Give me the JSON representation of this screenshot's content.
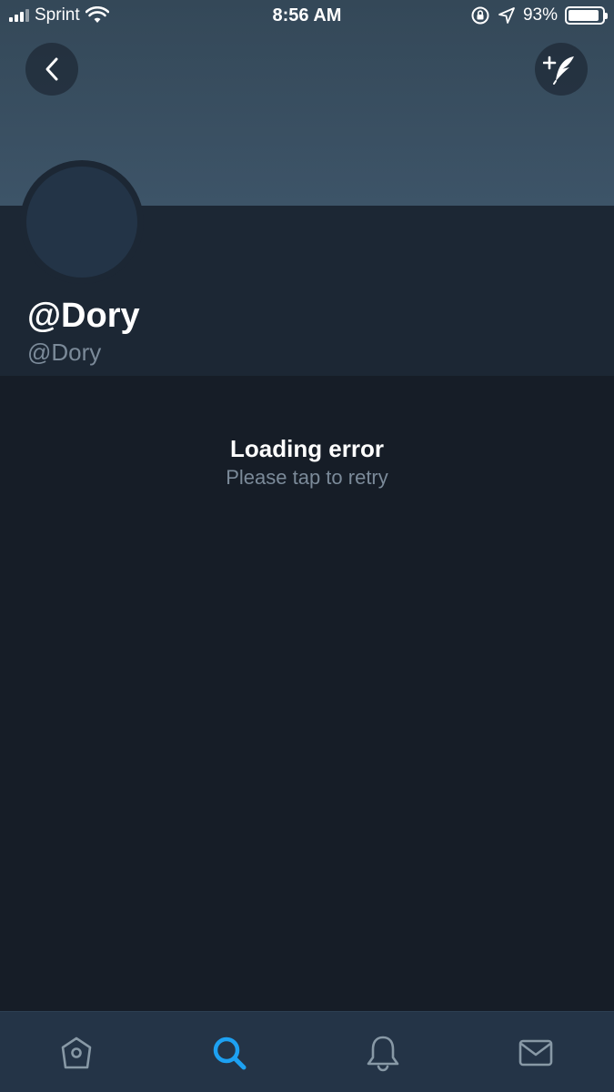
{
  "status_bar": {
    "carrier": "Sprint",
    "time": "8:56 AM",
    "battery_percent": "93%",
    "battery_level": 0.93
  },
  "header": {
    "back_icon": "chevron-left-icon",
    "compose_icon": "compose-tweet-icon"
  },
  "profile": {
    "display_name": "@Dory",
    "handle": "@Dory"
  },
  "error": {
    "title": "Loading error",
    "subtitle": "Please tap to retry"
  },
  "tab_bar": {
    "items": [
      {
        "icon": "home-icon",
        "active": false
      },
      {
        "icon": "search-icon",
        "active": true
      },
      {
        "icon": "notifications-icon",
        "active": false
      },
      {
        "icon": "messages-icon",
        "active": false
      }
    ]
  },
  "colors": {
    "accent": "#1da1f2",
    "background": "#161d27",
    "profile_bg": "#1c2734",
    "muted_text": "#7b8a99"
  }
}
